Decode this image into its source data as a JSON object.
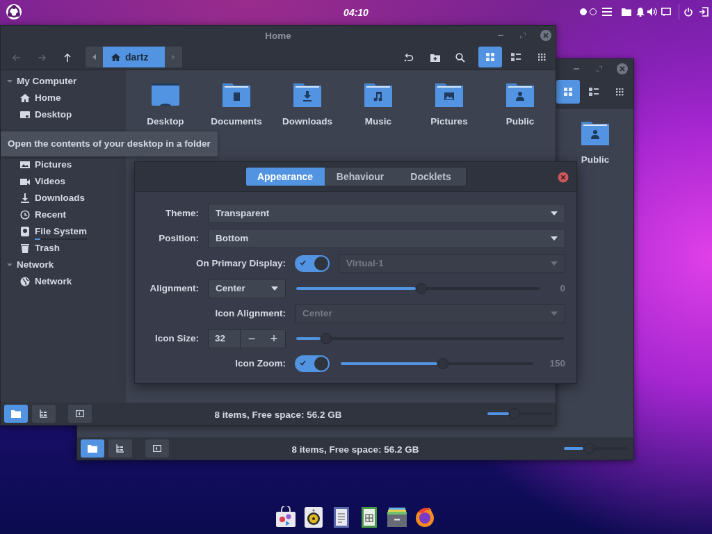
{
  "top_bar": {
    "clock": "04:10",
    "workspaces": [
      {
        "selected": true
      },
      {
        "selected": false
      }
    ]
  },
  "back_window": {
    "view_modes": [
      {
        "kind": "icons",
        "selected": true
      },
      {
        "kind": "list",
        "selected": false
      },
      {
        "kind": "compact",
        "selected": false
      }
    ],
    "files": [
      {
        "kind": "public",
        "label": "Public"
      }
    ],
    "pane_buttons": [
      {
        "kind": "places",
        "selected": true
      },
      {
        "kind": "tree",
        "selected": false
      },
      {
        "kind": "sidebar",
        "selected": false
      }
    ],
    "status": "8 items, Free space: 56.2 GB",
    "zoom": {
      "level": 0.3
    }
  },
  "front_window": {
    "title": "Home",
    "breadcrumb": {
      "label": "dartz",
      "selected": true
    },
    "view_modes": [
      {
        "kind": "icons",
        "selected": true
      },
      {
        "kind": "list",
        "selected": false
      },
      {
        "kind": "compact",
        "selected": false
      }
    ],
    "sidebar": [
      {
        "label": "My Computer",
        "expanded": true,
        "items": [
          {
            "kind": "home",
            "label": "Home"
          },
          {
            "kind": "desktop",
            "label": "Desktop"
          },
          {
            "kind": "tooltip",
            "text": "Open the contents of your desktop in a folder"
          },
          {
            "kind": "pictures",
            "label": "Pictures"
          },
          {
            "kind": "videos",
            "label": "Videos"
          },
          {
            "kind": "downloads",
            "label": "Downloads"
          },
          {
            "kind": "recent",
            "label": "Recent"
          },
          {
            "kind": "drive",
            "label": "File System",
            "level": 0.1
          },
          {
            "kind": "trash",
            "label": "Trash"
          }
        ]
      },
      {
        "label": "Network",
        "expanded": true,
        "items": [
          {
            "kind": "globe",
            "label": "Network"
          }
        ]
      }
    ],
    "files": [
      {
        "kind": "desktop",
        "label": "Desktop"
      },
      {
        "kind": "documents",
        "label": "Documents"
      },
      {
        "kind": "downloads",
        "label": "Downloads"
      },
      {
        "kind": "music",
        "label": "Music"
      },
      {
        "kind": "pictures",
        "label": "Pictures"
      },
      {
        "kind": "public",
        "label": "Public"
      }
    ],
    "pane_buttons": [
      {
        "kind": "places",
        "selected": true
      },
      {
        "kind": "tree",
        "selected": false
      },
      {
        "kind": "sidebar",
        "selected": false
      }
    ],
    "status": "8 items, Free space: 56.2 GB",
    "zoom": {
      "level": 0.34
    }
  },
  "dock_settings": {
    "tabs": [
      {
        "label": "Appearance",
        "selected": true
      },
      {
        "label": "Behaviour",
        "selected": false
      },
      {
        "label": "Docklets",
        "selected": false
      }
    ],
    "rows": [
      {
        "kind": "select",
        "label": "Theme:",
        "value": "Transparent",
        "disabled": false
      },
      {
        "kind": "select",
        "label": "Position:",
        "value": "Bottom",
        "disabled": false
      },
      {
        "kind": "toggle-select",
        "label": "On Primary Display:",
        "on": true,
        "value": "Virtual-1",
        "disabled": true
      },
      {
        "kind": "select-slider",
        "label": "Alignment:",
        "value": "Center",
        "disabled": false,
        "level": 0.49,
        "reading": "0"
      },
      {
        "kind": "wide-select",
        "label": "Icon Alignment:",
        "value": "Center",
        "disabled": true
      },
      {
        "kind": "spin-slider",
        "label": "Icon Size:",
        "value": "32",
        "minus": "−",
        "plus": "+",
        "level": 0.09
      },
      {
        "kind": "toggle-slider",
        "label": "Icon Zoom:",
        "on": true,
        "level": 0.5,
        "reading": "150"
      }
    ]
  },
  "dock": [
    {
      "kind": "bag"
    },
    {
      "kind": "speaker"
    },
    {
      "kind": "document"
    },
    {
      "kind": "spreadsheet"
    },
    {
      "kind": "drawer"
    },
    {
      "kind": "browser"
    }
  ]
}
